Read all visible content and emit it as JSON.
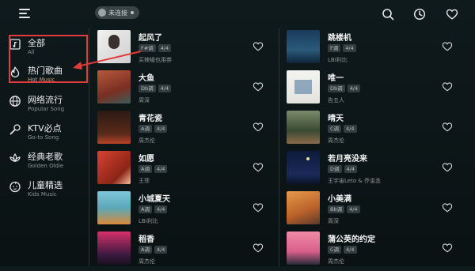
{
  "status": {
    "label": "未连接"
  },
  "sidebar": {
    "items": [
      {
        "cn": "全部",
        "en": "All",
        "icon": "music-note-square-icon"
      },
      {
        "cn": "热门歌曲",
        "en": "Hot Music",
        "icon": "flame-icon"
      },
      {
        "cn": "网络流行",
        "en": "Popular Song",
        "icon": "globe-icon"
      },
      {
        "cn": "KTV必点",
        "en": "Go-to Song",
        "icon": "microphone-icon"
      },
      {
        "cn": "经典老歌",
        "en": "Golden Oldie",
        "icon": "lotus-icon"
      },
      {
        "cn": "儿童精选",
        "en": "Kids Music",
        "icon": "child-face-icon"
      }
    ]
  },
  "left_songs": [
    {
      "title": "起风了",
      "key": "F#调",
      "meter": "4/4",
      "artist": "买辣椒也用券"
    },
    {
      "title": "大鱼",
      "key": "Db调",
      "meter": "4/4",
      "artist": "周深"
    },
    {
      "title": "青花瓷",
      "key": "A调",
      "meter": "4/4",
      "artist": "周杰伦"
    },
    {
      "title": "如愿",
      "key": "A调",
      "meter": "4/4",
      "artist": "王菲"
    },
    {
      "title": "小城夏天",
      "key": "A调",
      "meter": "4/4",
      "artist": "LBI利比"
    },
    {
      "title": "稻香",
      "key": "A调",
      "meter": "4/4",
      "artist": "周杰伦"
    }
  ],
  "right_songs": [
    {
      "title": "跳楼机",
      "key": "F调",
      "meter": "4/4",
      "artist": "LBI利比"
    },
    {
      "title": "唯一",
      "key": "Db调",
      "meter": "4/4",
      "artist": "告五人"
    },
    {
      "title": "晴天",
      "key": "C调",
      "meter": "4/4",
      "artist": "周杰伦"
    },
    {
      "title": "若月亮没来",
      "key": "D调",
      "meter": "4/4",
      "artist": "王宇宙Leto & 乔浚丞"
    },
    {
      "title": "小美满",
      "key": "Bb调",
      "meter": "4/4",
      "artist": "周深"
    },
    {
      "title": "蒲公英的约定",
      "key": "C调",
      "meter": "4/4",
      "artist": "周杰伦"
    }
  ],
  "colors": {
    "highlight": "#e23b3b",
    "accent": "#c7a07a"
  }
}
